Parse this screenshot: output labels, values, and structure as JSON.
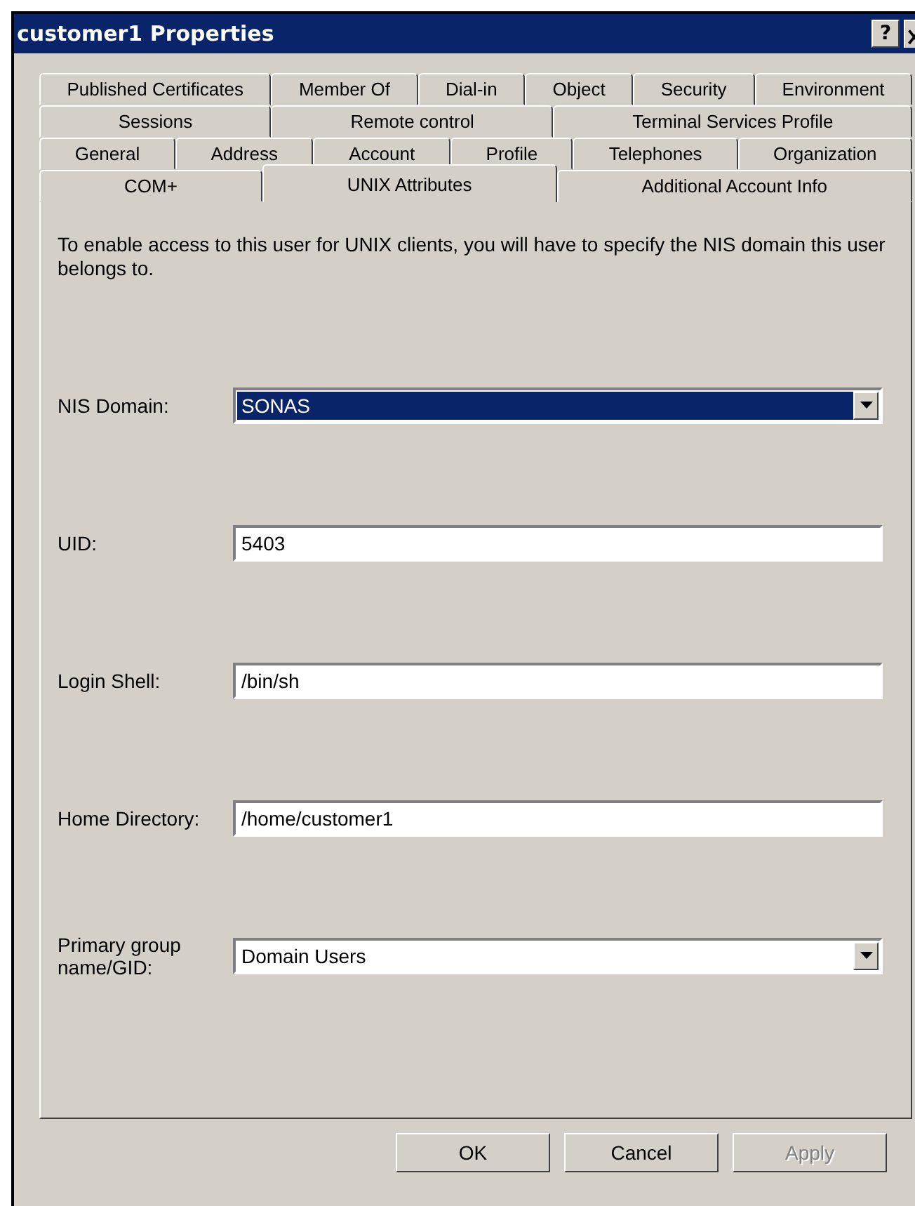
{
  "window": {
    "title": "customer1 Properties",
    "help": "?"
  },
  "tab_rows": [
    {
      "tabs": [
        {
          "label": "Published Certificates",
          "selected": false
        },
        {
          "label": "Member Of",
          "selected": false
        },
        {
          "label": "Dial-in",
          "selected": false
        },
        {
          "label": "Object",
          "selected": false
        },
        {
          "label": "Security",
          "selected": false
        },
        {
          "label": "Environment",
          "selected": false
        }
      ]
    },
    {
      "tabs": [
        {
          "label": "Sessions",
          "selected": false
        },
        {
          "label": "Remote control",
          "selected": false
        },
        {
          "label": "Terminal Services Profile",
          "selected": false
        }
      ]
    },
    {
      "tabs": [
        {
          "label": "General",
          "selected": false
        },
        {
          "label": "Address",
          "selected": false
        },
        {
          "label": "Account",
          "selected": false
        },
        {
          "label": "Profile",
          "selected": false
        },
        {
          "label": "Telephones",
          "selected": false
        },
        {
          "label": "Organization",
          "selected": false
        }
      ]
    },
    {
      "tabs": [
        {
          "label": "COM+",
          "selected": false
        },
        {
          "label": "UNIX Attributes",
          "selected": true
        },
        {
          "label": "Additional Account Info",
          "selected": false
        }
      ]
    }
  ],
  "description": "To enable access to this user for UNIX clients, you will have to specify the NIS domain this user belongs to.",
  "fields": [
    {
      "kind": "dropdown",
      "label": "NIS Domain:",
      "value": "SONAS",
      "highlighted": true
    },
    {
      "kind": "text",
      "label": "UID:",
      "value": "5403"
    },
    {
      "kind": "text",
      "label": "Login Shell:",
      "value": "/bin/sh"
    },
    {
      "kind": "text",
      "label": "Home Directory:",
      "value": "/home/customer1"
    },
    {
      "kind": "dropdown",
      "label": "Primary group name/GID:",
      "value": "Domain Users",
      "highlighted": false
    }
  ],
  "buttons": [
    {
      "label": "OK",
      "disabled": false
    },
    {
      "label": "Cancel",
      "disabled": false
    },
    {
      "label": "Apply",
      "disabled": true
    }
  ]
}
